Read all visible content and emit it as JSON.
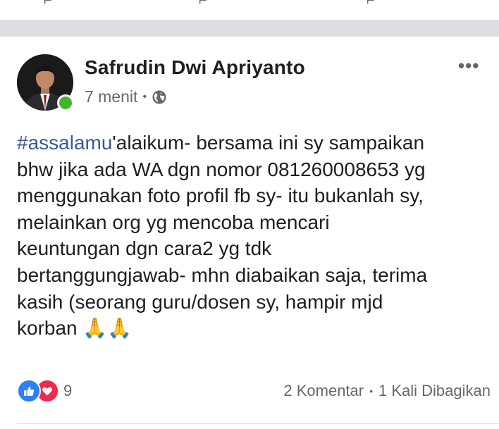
{
  "post": {
    "author": "Safrudin Dwi Apriyanto",
    "time": "7 menit",
    "meta_separator": "•",
    "privacy_icon": "globe-icon",
    "more_icon": "more-options-icon",
    "more_label": "•••",
    "hashtag": "#assalamu",
    "body_rest": "'alaikum- bersama ini sy sampaikan\nbhw jika ada WA dgn nomor 081260008653 yg\nmenggunakan foto profil fb sy- itu bukanlah sy,\nmelainkan org yg mencoba mencari\nkeuntungan dgn cara2 yg tdk\nbertanggungjawab- mhn diabaikan saja, terima\nkasih (seorang guru/dosen sy, hampir mjd\nkorban ",
    "emoji": "🙏🙏"
  },
  "reactions": {
    "icons": [
      "like-icon",
      "love-icon"
    ],
    "count": "9"
  },
  "stats": {
    "comments": "2 Komentar",
    "separator": "•",
    "shares": "1 Kali Dibagikan"
  },
  "colors": {
    "hashtag": "#385898",
    "like": "#2d7ff5",
    "love": "#f0284a",
    "online": "#44b42d",
    "separator_band": "#dcdee2"
  }
}
